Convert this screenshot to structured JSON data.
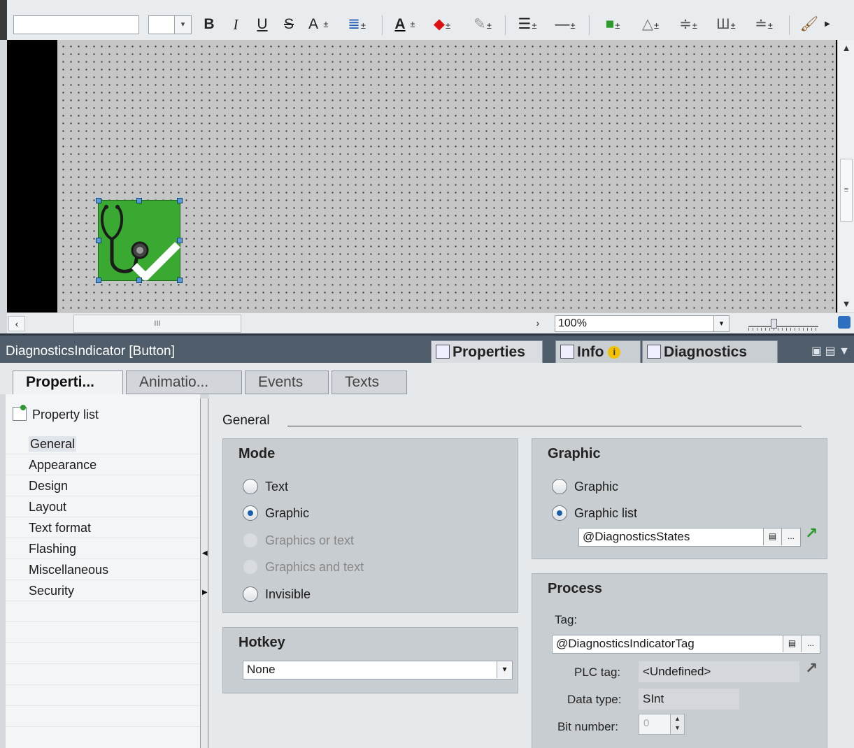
{
  "toolbar": {
    "font_name": "",
    "font_size": "",
    "bold": "B",
    "italic": "I",
    "underline": "U",
    "strike": "S",
    "font_grow": "A",
    "text_color": "A"
  },
  "canvas": {
    "selected_object_icon": "stethoscope-check-icon",
    "background_color": "#c6c6c6"
  },
  "scroll": {
    "zoom": "100%",
    "thumb_grip": "III",
    "vthumb_grip": "≡"
  },
  "inspector": {
    "title": "DiagnosticsIndicator [Button]",
    "panel_tabs": [
      "Properties",
      "Info",
      "Diagnostics"
    ],
    "subtabs": [
      "Properti...",
      "Animatio...",
      "Events",
      "Texts"
    ]
  },
  "nav": {
    "header": "Property list",
    "items": [
      "General",
      "Appearance",
      "Design",
      "Layout",
      "Text format",
      "Flashing",
      "Miscellaneous",
      "Security"
    ]
  },
  "content": {
    "section": "General",
    "mode": {
      "title": "Mode",
      "options": [
        "Text",
        "Graphic",
        "Graphics or text",
        "Graphics and text",
        "Invisible"
      ],
      "selected": "Graphic"
    },
    "hotkey": {
      "title": "Hotkey",
      "value": "None"
    },
    "graphic": {
      "title": "Graphic",
      "options": [
        "Graphic",
        "Graphic list"
      ],
      "selected": "Graphic list",
      "list_value": "@DiagnosticsStates",
      "browse": "..."
    },
    "process": {
      "title": "Process",
      "tag_label": "Tag:",
      "tag_value": "@DiagnosticsIndicatorTag",
      "plc_tag_label": "PLC tag:",
      "plc_tag_value": "<Undefined>",
      "data_type_label": "Data type:",
      "data_type_value": "SInt",
      "bit_number_label": "Bit number:",
      "bit_number_value": "0",
      "browse": "..."
    }
  },
  "colors": {
    "accent_green": "#3aa932",
    "header_bg": "#4f5d6b",
    "radio_dot": "#1a5fa8"
  }
}
